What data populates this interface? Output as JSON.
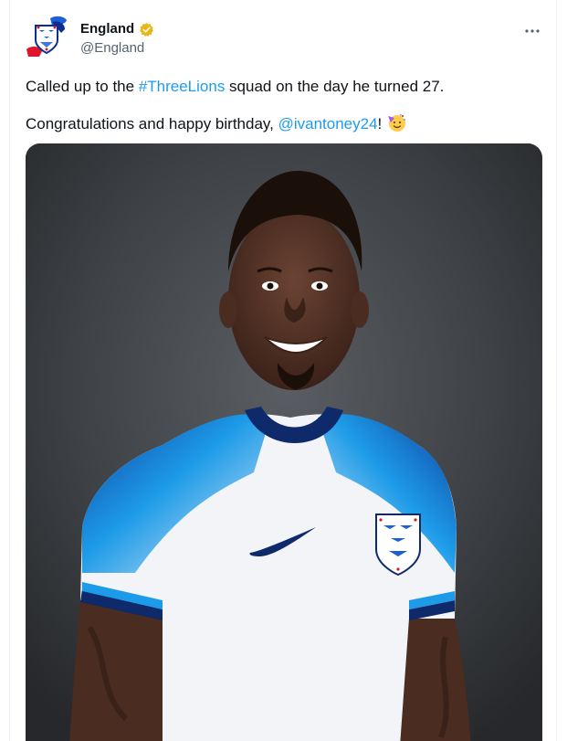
{
  "account": {
    "name": "England",
    "handle": "@England",
    "verified": true,
    "badge_color": "#e8b81a",
    "avatar_icon": "three-lions-crest-icon"
  },
  "menu": {
    "more_icon": "more-dots-icon",
    "more_glyph": "···"
  },
  "tweet": {
    "line1": {
      "before": "Called up to the ",
      "hashtag": "#ThreeLions",
      "after": " squad on the day he turned 27."
    },
    "line2": {
      "before": "Congratulations and happy birthday, ",
      "mention": "@ivantoney24",
      "after": "!",
      "emoji_icon": "party-face-emoji-icon"
    }
  },
  "media": {
    "image_icon": "player-photo-england-kit",
    "background_color": "#3a3d40",
    "shirt_color": "#f2f4f7",
    "shoulder_color": "#1d8fe0",
    "collar_color": "#0e2a6b"
  },
  "colors": {
    "link": "#1d9bf0",
    "text": "#0f1419",
    "secondary_text": "#536471"
  }
}
